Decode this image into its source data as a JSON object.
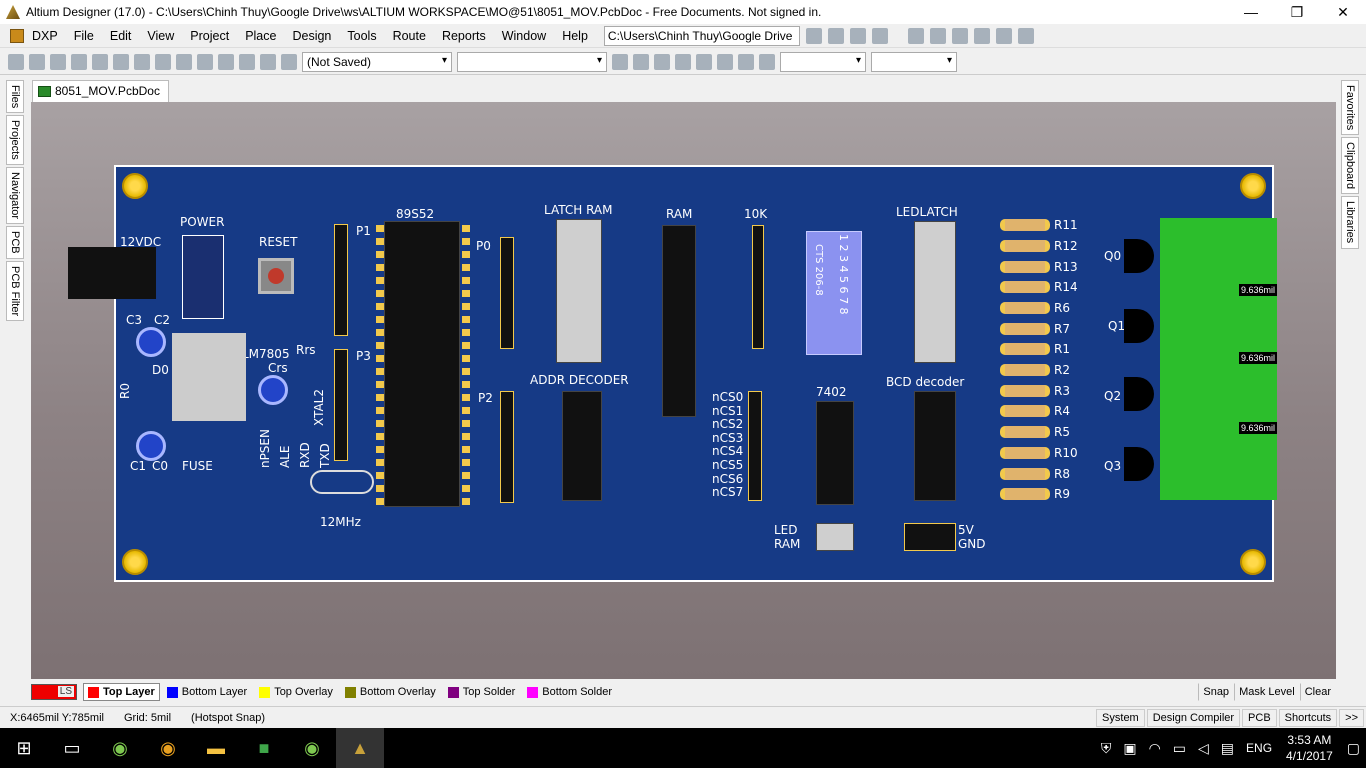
{
  "titlebar": {
    "title": "Altium Designer (17.0) - C:\\Users\\Chinh Thuy\\Google Drive\\ws\\ALTIUM WORKSPACE\\MO@51\\8051_MOV.PcbDoc - Free Documents. Not signed in.",
    "minimize": "—",
    "maximize": "❐",
    "close": "✕"
  },
  "menu": [
    "DXP",
    "File",
    "Edit",
    "View",
    "Project",
    "Place",
    "Design",
    "Tools",
    "Route",
    "Reports",
    "Window",
    "Help"
  ],
  "path_box": "C:\\Users\\Chinh Thuy\\Google Drive",
  "toolbar2": {
    "variant": "(Not Saved)"
  },
  "left_tabs": [
    "Files",
    "Projects",
    "Navigator",
    "PCB",
    "PCB Filter"
  ],
  "right_tabs": [
    "Favorites",
    "Clipboard",
    "Libraries"
  ],
  "doc_tab": "8051_MOV.PcbDoc",
  "board": {
    "labels": {
      "power": "POWER",
      "reset": "RESET",
      "v12": "12VDC",
      "p1": "P1",
      "p0": "P0",
      "p2": "P2",
      "p3": "P3",
      "mcu": "89S52",
      "latch_ram": "LATCH RAM",
      "ram": "RAM",
      "k10": "10K",
      "ledlatch": "LEDLATCH",
      "addr": "ADDR DECODER",
      "bcd": "BCD decoder",
      "z7402": "7402",
      "lm": "LM7805",
      "rrs": "Rrs",
      "crs": "Crs",
      "xtal": "XTAL2",
      "c3": "C3",
      "c2": "C2",
      "c1": "C1",
      "c0": "C0",
      "d0": "D0",
      "r0": "R0",
      "fuse": "FUSE",
      "mhz": "12MHz",
      "npsen": "nPSEN",
      "ale": "ALE",
      "rxd": "RXD",
      "txd": "TXD",
      "led": "LED",
      "ramlbl": "RAM",
      "v5": "5V",
      "gnd": "GND",
      "dipsw": "CTS 206-8",
      "dipnums": "1 2 3 4 5 6 7 8"
    },
    "ncs": [
      "nCS0",
      "nCS1",
      "nCS2",
      "nCS3",
      "nCS4",
      "nCS5",
      "nCS6",
      "nCS7"
    ],
    "resistors": [
      "R11",
      "R12",
      "R13",
      "R14",
      "R6",
      "R7",
      "R1",
      "R2",
      "R3",
      "R4",
      "R5",
      "R10",
      "R8",
      "R9"
    ],
    "transistors": [
      "Q0",
      "Q1",
      "Q2",
      "Q3"
    ],
    "dims": [
      "9.636mil",
      "9.636mil",
      "9.636mil"
    ]
  },
  "layers": [
    {
      "name": "Top Layer",
      "color": "#ff0000",
      "active": true
    },
    {
      "name": "Bottom Layer",
      "color": "#0000ff",
      "active": false
    },
    {
      "name": "Top Overlay",
      "color": "#ffff00",
      "active": false
    },
    {
      "name": "Bottom Overlay",
      "color": "#808000",
      "active": false
    },
    {
      "name": "Top Solder",
      "color": "#800080",
      "active": false
    },
    {
      "name": "Bottom Solder",
      "color": "#ff00ff",
      "active": false
    }
  ],
  "ls_label": "LS",
  "layer_right": [
    "Snap",
    "Mask Level",
    "Clear"
  ],
  "status": {
    "coords": "X:6465mil Y:785mil",
    "grid": "Grid: 5mil",
    "snap": "(Hotspot Snap)",
    "buttons": [
      "System",
      "Design Compiler",
      "PCB",
      "Shortcuts",
      ">>"
    ]
  },
  "tray": {
    "lang": "ENG",
    "time": "3:53 AM",
    "date": "4/1/2017"
  }
}
